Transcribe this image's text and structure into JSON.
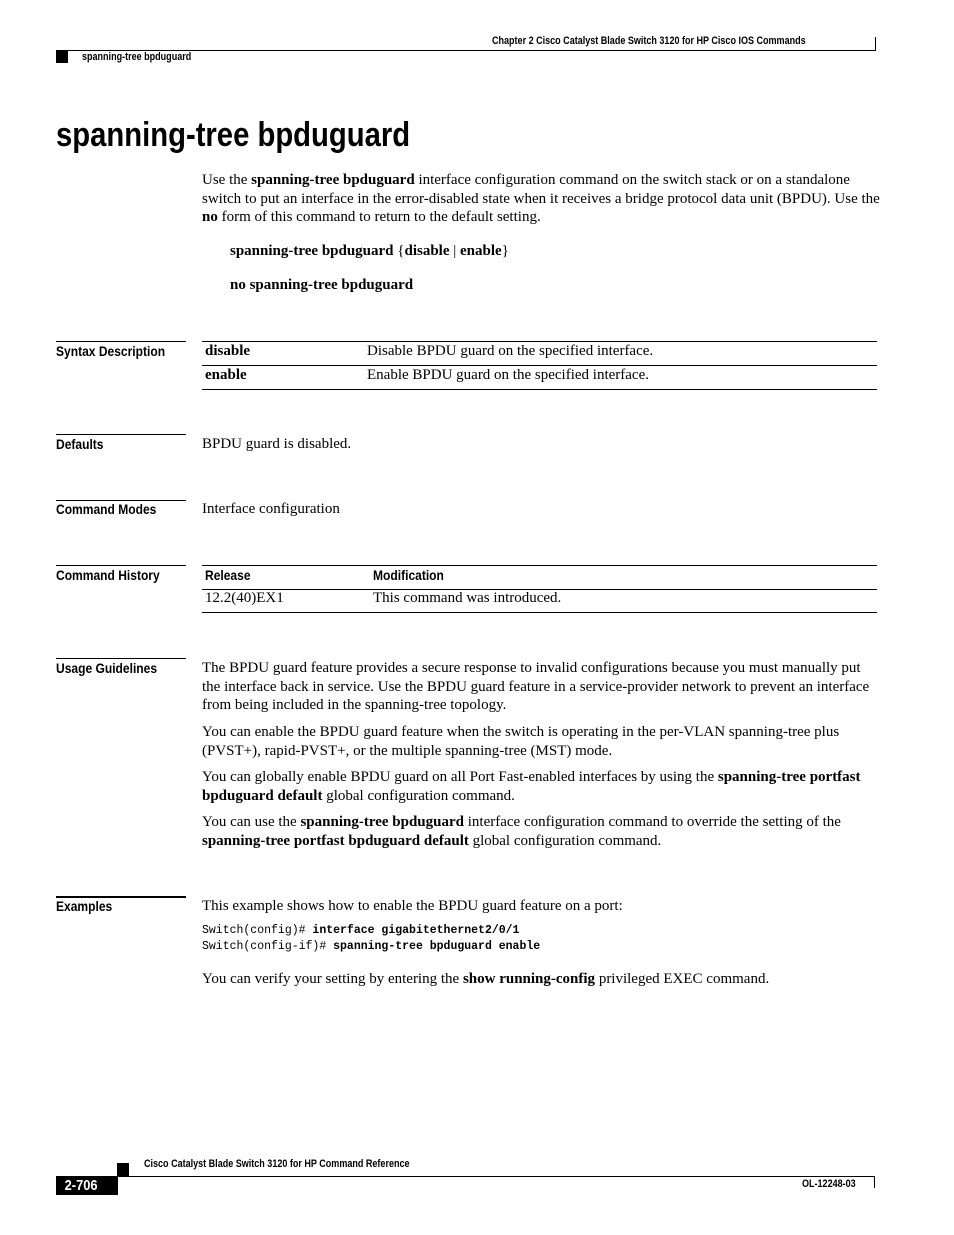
{
  "header": {
    "chapter": "Chapter  2 Cisco Catalyst Blade Switch 3120 for HP Cisco IOS Commands",
    "running_title": "spanning-tree bpduguard"
  },
  "title": "spanning-tree bpduguard",
  "intro": {
    "t1": "Use the ",
    "b1": "spanning-tree bpduguard",
    "t2": " interface configuration command on the switch stack or on a standalone switch to put an interface in the error-disabled state when it receives a bridge protocol data unit (BPDU). Use the ",
    "b2": "no",
    "t3": " form of this command to return to the default setting."
  },
  "syntax": {
    "line1_cmd": "spanning-tree bpduguard ",
    "line1_open": "{",
    "line1_opt1": "disable",
    "line1_sep": " | ",
    "line1_opt2": "enable",
    "line1_close": "}",
    "line2": "no spanning-tree bpduguard"
  },
  "sections": {
    "syntax_description": {
      "label": "Syntax Description",
      "rows": [
        {
          "keyword": "disable",
          "description": "Disable BPDU guard on the specified interface."
        },
        {
          "keyword": "enable",
          "description": "Enable BPDU guard on the specified interface."
        }
      ]
    },
    "defaults": {
      "label": "Defaults",
      "text": "BPDU guard is disabled."
    },
    "command_modes": {
      "label": "Command Modes",
      "text": "Interface configuration"
    },
    "command_history": {
      "label": "Command History",
      "columns": [
        "Release",
        "Modification"
      ],
      "rows": [
        {
          "release": "12.2(40)EX1",
          "modification": "This command was introduced."
        }
      ]
    },
    "usage_guidelines": {
      "label": "Usage Guidelines",
      "p1": "The BPDU guard feature provides a secure response to invalid configurations because you must manually put the interface back in service. Use the BPDU guard feature in a service-provider network to prevent an interface from being included in the spanning-tree topology.",
      "p2": "You can enable the BPDU guard feature when the switch is operating in the per-VLAN spanning-tree plus (PVST+), rapid-PVST+, or the multiple spanning-tree (MST) mode.",
      "p3": {
        "t1": "You can globally enable BPDU guard on all Port Fast-enabled interfaces by using the ",
        "b1": "spanning-tree portfast bpduguard default",
        "t2": " global configuration command."
      },
      "p4": {
        "t1": "You can use the ",
        "b1": "spanning-tree bpduguard",
        "t2": " interface configuration command to override the setting of the ",
        "b2": "spanning-tree portfast bpduguard default",
        "t3": " global configuration command."
      }
    },
    "examples": {
      "label": "Examples",
      "intro": "This example shows how to enable the BPDU guard feature on a port:",
      "code": [
        {
          "prompt": "Switch(config)# ",
          "command": "interface gigabitethernet2/0/1"
        },
        {
          "prompt": "Switch(config-if)# ",
          "command": "spanning-tree bpduguard enable"
        }
      ],
      "outro": {
        "t1": "You can verify your setting by entering the ",
        "b1": "show running-config",
        "t2": " privileged EXEC command."
      }
    }
  },
  "footer": {
    "book_title": "Cisco Catalyst Blade Switch 3120 for HP Command Reference",
    "page_number": "2-706",
    "doc_id": "OL-12248-03"
  }
}
